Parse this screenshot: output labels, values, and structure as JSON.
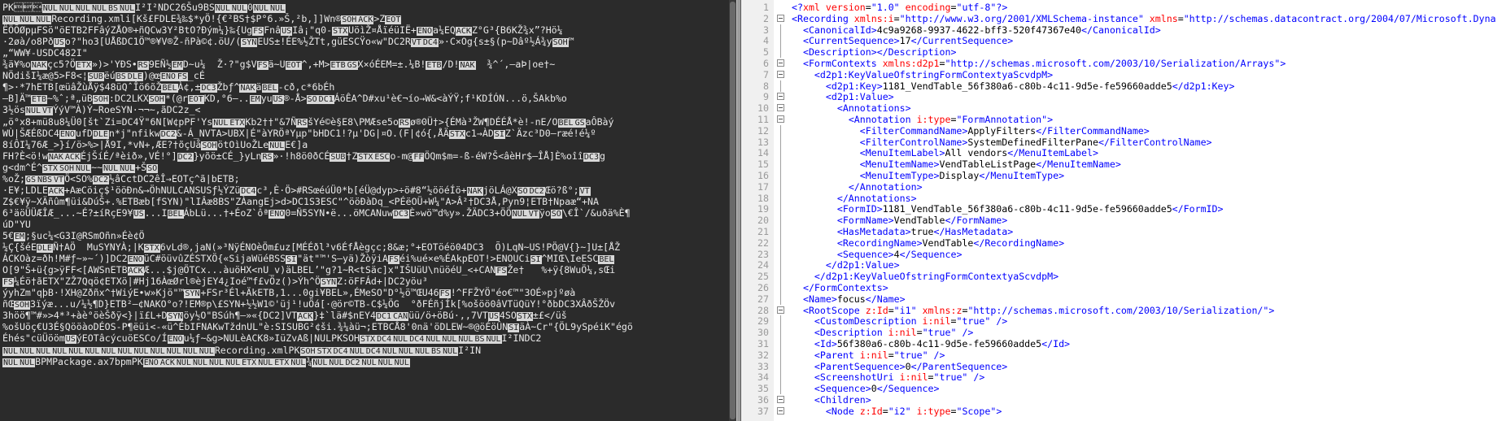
{
  "left_pane": {
    "lines": [
      "PK\u0003\u0004 \u0014 NUL NUL NUL NUL BS NUL I²I²NDC26Šu9BS NUL NUL 0 NUL NUL",
      "NUL NUL NUL Recording.xmli[Kš£F DLE¾‰$*yÖ!{€²BS †$P° 6.»Š,²b,]]Wn® SOH ACK >Z EOT",
      "ËÖÕØpµFS ö\"öETB 2FF âýZÅO®+ñQCw3Y²BtO?Ðým¼}‰{Ug FS Fnâ US Iâ¡\"q0- STX UöìŽ¤ÅïéüIË+ ENO a¼EQ ACK Z°G³{B6KŽ¾x”?Hö ¼",
      "·2øà/o8Pð US o?\"ho3[UÅßDC1Ö™®¥V®Ž- ñPà©¢.öU/( SYN EUS ±!ÉE%½ŽTt,güESC Ÿ o« w\"DC2 R VT DC4 »·C×Og{s±§(p~Dâº½Á¾y SOH ™",
      "„“WW¥-USDC482I\"",
      "¾ä¥%o NAK çc5?Ö ETX »)>'YÐS• RS 9EÑ½ EM D~u¼  Ž·?\"g$V FS ä~U EOT ^,+M> ETB GS X×óÉEM =±.¼B! ETB /D! NAK  ¾^´‚ —aÞ|oe†~",
      "NÖdišI¼æ@5>F8<¦ SUB ëú BS DLE )@œ ENO FS _cÉ",
      "¶>·*7hETB [œüâŽùÅÿ$48üQˆ Îö6õŽ BEL À¢,± DC3 Ž bƒ^ NAK ä BEL -cð,c*6bÉh",
      "—B]Ä™ ETB ~%ˆ;ª„üB SOH :DC2L KX SOH *(@r EOT KD,°6—.. EM yu US ®-Å> SO DC1 ÁöÊA^D#xu¹è€¬ío→W&<àÝŸ;f¹KDÍÓN...ö,ŠAkb%o",
      "3½ös NUL VT ÝýV™À)Ý~RoeSYN ·¬¬~,ãDC2z_<",
      "„ö°x8+mü8u8¼Ü0[št`Zi=DC4 Ÿ\"6N[W¢pPF'Ys NUL ETX Kb2††\"&7Ñ RS šYé©è§E8\\PMÆse5o RS ø®0Ü†>{ÉMà³ŽW¶DÉÉÅ*è!-nE/O BEL GS aÔBàý",
      "W Ù|ŠÆÉßDC4 ENO ufD DLE n*j\"nfikw DC2 &-Á_NVT A>UBX|É\"àYRÖªYµp\"b HDC1 !?µ'DG|¤O.(F|¢ó {,ÅÄ STX c1→ÀD SI Z`Äzc³D0—ræé!é¼º",
      "8íÔI¼76Æ_>}í/ö>%>|Å9I,*vN+,ÆE?†õçUå SOH ötOìUoŽLe NUL E€]a",
      "FH?È<ö!w NAK ACK ÉjŠíÉ/ªèið»,VÉ!°] DC2 }yõö±CÉ_}yLn RS »·!h8ö0ðCÉ SUB †Z STX ESC o-m@ FF ÖQm$m=-ß-éW?Š<âèHr$—ÎÅ]È%oîî DC3 g",
      "g<dm^É^ STX SOH NUL ~~ NUL NUL +Š SO",
      "%oŽ; GS NBS VT Ö<SO % DC2 ½âCctDC2êÎ→EOT ç^ã|bETB;",
      "·E¥;LDLE ACK +AæCöiç$¹ööÐn&→ÖhNULCAN SUSƒ½ÝZü DC4 c³,È·Ö>#RS œéúÜ0*b[éÜ@dyp>÷ö#8“½ööéÍö+ NAK jöLÁ@X SO DC2 Œö ?ß°; VT",
      "Z$€¥ÿ~XÄñûm¶üi&DúŠ+.%ETB æb[fSYN)\"lIÂæ8BS \"ZÀangEj>d>DC1 S3ESC \"^ööÐàDq_<PÉëOÜ +W¼\"A>Â²†DC3 Å,Pyn9¦ETB †Npaæ“+ NA",
      "6³äöÜÜÆÎÆ_...~É?±íRçE9¥ US ...I BEL ÁbLü...†+ÉoZ`ôª ENO 0=Ñ 5SYN •ë...öMCAN uw DC3 È»wö™d%y».ŽÄDC3+ÖÖ NUL VT ÿo SO \\€Î`/&uðä %È¶",
      "úD \"YU",
      "5€ EM ;§uc¼<G3I @RS mOñn»Éè¢Ö",
      "¼Ç{šéE DLE Ñ†AÖ  MuSYN YÀ;|K STX 6vLd®,jaN(»³NÿÉNOèÖm£uz[MÉÉðl³v6ÉfÅègçc;8&æ;°+EOT öéö0 4DC3  Õ)LqN~US !PÖ@V{}~]U±[ÅŽ",
      "ÁCKOàz=ðh!M#ƒ~»~´)]DC2 ENO üC#öüvûZÉSTX Ö{« Sija WüéBSS SI \"ät\"™'S—yä)ŽòÿiA FS éi%ué×e%ÉAkpEOT !>ENO UCi SI ^MI Œ\\IeESC BEL",
      "O[9\"Š+ü{g>ÿFF <[AWSnETB ACK Æ...$j@ÖTCx...àuöHX<nU_v)äLBEL’\"g?1~R<tSäc]x\"IŠUüU\\nüöéU_<+CAN FS Že†   %+ÿ{8WuÖ¼,sŒi",
      "FS ¼Éö† ãETX \"ZŽ7Qqö¢ETX ö|#Hj16ÀœØrl®èjEY4¿Ioé™f£vÖz()>Ýh^Ö SYN Z:öFF Ád+|DC2 yöu³",
      "ýyhZm\"qþB·!XH@ Zðñx^† WiýE•w» Kjö\"™ SYN +FS r³Él+ÄkETB,1...0gi¥BEL »,ÉMe SO\"D°½ö™ ŒU46 FS !^FF ŽYÖ \"éo€™\"3OÉ»pjºøà",
      "ñŒ SOH 3ïýæ...u/¼½¶D}ETB ²—¢NAK O°o?!EM ®p\\£SYN +½½W1©'üj¹!uÖá[·@ör©TB-C$¼ÖG  °ðFÉñjÍk[%ošöö0âVT üQüY!°ðbDC3 XÂðŠŽ Öv",
      " 3höö¶™#»>4*³+àè°öèŠðÿ<}|ï£L+D SYN öy½O\"BS úh¶— »«{DC2 ]VT ACK }‡`lä#$nEY4 DC1 CAN üü/ö+öBú·,,7VT US 4SO STX ±£</üš",
      "%ošUöç€U3É§QööàoDÉOS-P¶ëüi<-«ü^ÉbIFNAK wTždnUL\"è:SISUB G²¢ši.¾¼àü¬;ETB CÅ8'0nä'öDLE W~®@öÉöÛN SI äÀ~Cr\"{ÖL9ySpéiK\"égö",
      "Éhés\"cüÜööm US ýEOT âcýcuöESC o/Í ENO u¼ƒ~&g>NUL èACK 8»IüZvAß|NUL PKSOH STX DC4 NUL DC4 NUL NUL NUL BS NUL I²INDC2",
      "NUL NUL NUL NUL NUL NUL NUL NUL NUL NUL NUL NUL NUL Recording.xmlPK SOH STX DC4 NUL DC4 NUL NUL NUL BS NUL I²IN",
      "NUL NUL BPMPackage.ax7bpmPK ENO ACK NUL NUL NUL NUL ETX NUL ETX NUL ¾ NUL NUL DC2 NUL NUL NUL"
    ]
  },
  "right_pane": {
    "xml_lines": [
      {
        "n": "1",
        "fold": "",
        "segs": [
          [
            "t",
            "<?"
          ],
          [
            "a",
            "xml"
          ],
          [
            "x",
            " "
          ],
          [
            "a",
            "version"
          ],
          [
            "x",
            "="
          ],
          [
            "v",
            "\"1.0\""
          ],
          [
            "x",
            " "
          ],
          [
            "a",
            "encoding"
          ],
          [
            "x",
            "="
          ],
          [
            "v",
            "\"utf-8\""
          ],
          [
            "t",
            "?>"
          ]
        ]
      },
      {
        "n": "2",
        "fold": "box",
        "segs": [
          [
            "t",
            "<Recording"
          ],
          [
            "x",
            " "
          ],
          [
            "a",
            "xmlns:i"
          ],
          [
            "x",
            "="
          ],
          [
            "v",
            "\"http://www.w3.org/2001/XMLSchema-instance\""
          ],
          [
            "x",
            " "
          ],
          [
            "a",
            "xmlns"
          ],
          [
            "x",
            "="
          ],
          [
            "v",
            "\"http://schemas.datacontract.org/2004/07/Microsoft.Dyna"
          ]
        ]
      },
      {
        "n": "3",
        "fold": "",
        "segs": [
          [
            "x",
            "  "
          ],
          [
            "t",
            "<CanonicalId>"
          ],
          [
            "x",
            "4c9a9268-9937-4622-bff3-520f47367e40"
          ],
          [
            "t",
            "</CanonicalId>"
          ]
        ]
      },
      {
        "n": "4",
        "fold": "",
        "segs": [
          [
            "x",
            "  "
          ],
          [
            "t",
            "<CurrentSequence>"
          ],
          [
            "x",
            "17"
          ],
          [
            "t",
            "</CurrentSequence>"
          ]
        ]
      },
      {
        "n": "5",
        "fold": "",
        "segs": [
          [
            "x",
            "  "
          ],
          [
            "t",
            "<Description>"
          ],
          [
            "t",
            "</Description>"
          ]
        ]
      },
      {
        "n": "6",
        "fold": "box",
        "segs": [
          [
            "x",
            "  "
          ],
          [
            "t",
            "<FormContexts"
          ],
          [
            "x",
            " "
          ],
          [
            "a",
            "xmlns:d2p1"
          ],
          [
            "x",
            "="
          ],
          [
            "v",
            "\"http://schemas.microsoft.com/2003/10/Serialization/Arrays\""
          ],
          [
            "t",
            ">"
          ]
        ]
      },
      {
        "n": "7",
        "fold": "box",
        "segs": [
          [
            "x",
            "    "
          ],
          [
            "t",
            "<d2p1:KeyValueOfstringFormContextyaScvdpM>"
          ]
        ]
      },
      {
        "n": "8",
        "fold": "",
        "segs": [
          [
            "x",
            "      "
          ],
          [
            "t",
            "<d2p1:Key>"
          ],
          [
            "x",
            "1181_VendTable_56f380a6-c80b-4c11-9d5e-fe59660adde5"
          ],
          [
            "t",
            "</d2p1:Key>"
          ]
        ]
      },
      {
        "n": "9",
        "fold": "box",
        "segs": [
          [
            "x",
            "      "
          ],
          [
            "t",
            "<d2p1:Value>"
          ]
        ]
      },
      {
        "n": "10",
        "fold": "box",
        "segs": [
          [
            "x",
            "        "
          ],
          [
            "t",
            "<Annotations>"
          ]
        ]
      },
      {
        "n": "11",
        "fold": "box",
        "segs": [
          [
            "x",
            "          "
          ],
          [
            "t",
            "<Annotation"
          ],
          [
            "x",
            " "
          ],
          [
            "a",
            "i:type"
          ],
          [
            "x",
            "="
          ],
          [
            "v",
            "\"FormAnnotation\""
          ],
          [
            "t",
            ">"
          ]
        ]
      },
      {
        "n": "12",
        "fold": "",
        "segs": [
          [
            "x",
            "            "
          ],
          [
            "t",
            "<FilterCommandName>"
          ],
          [
            "x",
            "ApplyFilters"
          ],
          [
            "t",
            "</FilterCommandName>"
          ]
        ]
      },
      {
        "n": "13",
        "fold": "",
        "segs": [
          [
            "x",
            "            "
          ],
          [
            "t",
            "<FilterControlName>"
          ],
          [
            "x",
            "SystemDefinedFilterPane"
          ],
          [
            "t",
            "</FilterControlName>"
          ]
        ]
      },
      {
        "n": "14",
        "fold": "",
        "segs": [
          [
            "x",
            "            "
          ],
          [
            "t",
            "<MenuItemLabel>"
          ],
          [
            "x",
            "All vendors"
          ],
          [
            "t",
            "</MenuItemLabel>"
          ]
        ]
      },
      {
        "n": "15",
        "fold": "",
        "segs": [
          [
            "x",
            "            "
          ],
          [
            "t",
            "<MenuItemName>"
          ],
          [
            "x",
            "VendTableListPage"
          ],
          [
            "t",
            "</MenuItemName>"
          ]
        ]
      },
      {
        "n": "16",
        "fold": "",
        "segs": [
          [
            "x",
            "            "
          ],
          [
            "t",
            "<MenuItemType>"
          ],
          [
            "x",
            "Display"
          ],
          [
            "t",
            "</MenuItemType>"
          ]
        ]
      },
      {
        "n": "17",
        "fold": "",
        "segs": [
          [
            "x",
            "          "
          ],
          [
            "t",
            "</Annotation>"
          ]
        ]
      },
      {
        "n": "18",
        "fold": "",
        "segs": [
          [
            "x",
            "        "
          ],
          [
            "t",
            "</Annotations>"
          ]
        ]
      },
      {
        "n": "19",
        "fold": "",
        "segs": [
          [
            "x",
            "        "
          ],
          [
            "t",
            "<FormID>"
          ],
          [
            "x",
            "1181_VendTable_56f380a6-c80b-4c11-9d5e-fe59660adde5"
          ],
          [
            "t",
            "</FormID>"
          ]
        ]
      },
      {
        "n": "20",
        "fold": "",
        "segs": [
          [
            "x",
            "        "
          ],
          [
            "t",
            "<FormName>"
          ],
          [
            "x",
            "VendTable"
          ],
          [
            "t",
            "</FormName>"
          ]
        ]
      },
      {
        "n": "21",
        "fold": "",
        "segs": [
          [
            "x",
            "        "
          ],
          [
            "t",
            "<HasMetadata>"
          ],
          [
            "x",
            "true"
          ],
          [
            "t",
            "</HasMetadata>"
          ]
        ]
      },
      {
        "n": "22",
        "fold": "",
        "segs": [
          [
            "x",
            "        "
          ],
          [
            "t",
            "<RecordingName>"
          ],
          [
            "x",
            "VendTable"
          ],
          [
            "t",
            "</RecordingName>"
          ]
        ]
      },
      {
        "n": "23",
        "fold": "",
        "segs": [
          [
            "x",
            "        "
          ],
          [
            "t",
            "<Sequence>"
          ],
          [
            "x",
            "4"
          ],
          [
            "t",
            "</Sequence>"
          ]
        ]
      },
      {
        "n": "24",
        "fold": "",
        "segs": [
          [
            "x",
            "      "
          ],
          [
            "t",
            "</d2p1:Value>"
          ]
        ]
      },
      {
        "n": "25",
        "fold": "",
        "segs": [
          [
            "x",
            "    "
          ],
          [
            "t",
            "</d2p1:KeyValueOfstringFormContextyaScvdpM>"
          ]
        ]
      },
      {
        "n": "26",
        "fold": "",
        "segs": [
          [
            "x",
            "  "
          ],
          [
            "t",
            "</FormContexts>"
          ]
        ]
      },
      {
        "n": "27",
        "fold": "",
        "segs": [
          [
            "x",
            "  "
          ],
          [
            "t",
            "<Name>"
          ],
          [
            "x",
            "focus"
          ],
          [
            "t",
            "</Name>"
          ]
        ]
      },
      {
        "n": "28",
        "fold": "box",
        "segs": [
          [
            "x",
            "  "
          ],
          [
            "t",
            "<RootScope"
          ],
          [
            "x",
            " "
          ],
          [
            "a",
            "z:Id"
          ],
          [
            "x",
            "="
          ],
          [
            "v",
            "\"i1\""
          ],
          [
            "x",
            " "
          ],
          [
            "a",
            "xmlns:z"
          ],
          [
            "x",
            "="
          ],
          [
            "v",
            "\"http://schemas.microsoft.com/2003/10/Serialization/\""
          ],
          [
            "t",
            ">"
          ]
        ]
      },
      {
        "n": "29",
        "fold": "",
        "segs": [
          [
            "x",
            "    "
          ],
          [
            "t",
            "<CustomDescription"
          ],
          [
            "x",
            " "
          ],
          [
            "a",
            "i:nil"
          ],
          [
            "x",
            "="
          ],
          [
            "v",
            "\"true\""
          ],
          [
            "x",
            " "
          ],
          [
            "t",
            "/>"
          ]
        ]
      },
      {
        "n": "30",
        "fold": "",
        "segs": [
          [
            "x",
            "    "
          ],
          [
            "t",
            "<Description"
          ],
          [
            "x",
            " "
          ],
          [
            "a",
            "i:nil"
          ],
          [
            "x",
            "="
          ],
          [
            "v",
            "\"true\""
          ],
          [
            "x",
            " "
          ],
          [
            "t",
            "/>"
          ]
        ]
      },
      {
        "n": "31",
        "fold": "",
        "segs": [
          [
            "x",
            "    "
          ],
          [
            "t",
            "<Id>"
          ],
          [
            "x",
            "56f380a6-c80b-4c11-9d5e-fe59660adde5"
          ],
          [
            "t",
            "</Id>"
          ]
        ]
      },
      {
        "n": "32",
        "fold": "",
        "segs": [
          [
            "x",
            "    "
          ],
          [
            "t",
            "<Parent"
          ],
          [
            "x",
            " "
          ],
          [
            "a",
            "i:nil"
          ],
          [
            "x",
            "="
          ],
          [
            "v",
            "\"true\""
          ],
          [
            "x",
            " "
          ],
          [
            "t",
            "/>"
          ]
        ]
      },
      {
        "n": "33",
        "fold": "",
        "segs": [
          [
            "x",
            "    "
          ],
          [
            "t",
            "<ParentSequence>"
          ],
          [
            "x",
            "0"
          ],
          [
            "t",
            "</ParentSequence>"
          ]
        ]
      },
      {
        "n": "34",
        "fold": "",
        "segs": [
          [
            "x",
            "    "
          ],
          [
            "t",
            "<ScreenshotUri"
          ],
          [
            "x",
            " "
          ],
          [
            "a",
            "i:nil"
          ],
          [
            "x",
            "="
          ],
          [
            "v",
            "\"true\""
          ],
          [
            "x",
            " "
          ],
          [
            "t",
            "/>"
          ]
        ]
      },
      {
        "n": "35",
        "fold": "",
        "segs": [
          [
            "x",
            "    "
          ],
          [
            "t",
            "<Sequence>"
          ],
          [
            "x",
            "0"
          ],
          [
            "t",
            "</Sequence>"
          ]
        ]
      },
      {
        "n": "36",
        "fold": "box",
        "segs": [
          [
            "x",
            "    "
          ],
          [
            "t",
            "<Children>"
          ]
        ]
      },
      {
        "n": "37",
        "fold": "box",
        "segs": [
          [
            "x",
            "      "
          ],
          [
            "t",
            "<Node"
          ],
          [
            "x",
            " "
          ],
          [
            "a",
            "z:Id"
          ],
          [
            "x",
            "="
          ],
          [
            "v",
            "\"i2\""
          ],
          [
            "x",
            " "
          ],
          [
            "a",
            "i:type"
          ],
          [
            "x",
            "="
          ],
          [
            "v",
            "\"Scope\""
          ],
          [
            "t",
            ">"
          ]
        ]
      }
    ]
  },
  "colors": {
    "left_bg": "#2b2b2b",
    "left_text": "#e8e8e8",
    "ctrl_chip_bg": "#d8d8d8",
    "ctrl_chip_text": "#1a1a1a",
    "xml_tag": "#0000ff",
    "xml_attr": "#ff0000",
    "xml_text": "#000000",
    "line_number": "#9a9a9a"
  }
}
